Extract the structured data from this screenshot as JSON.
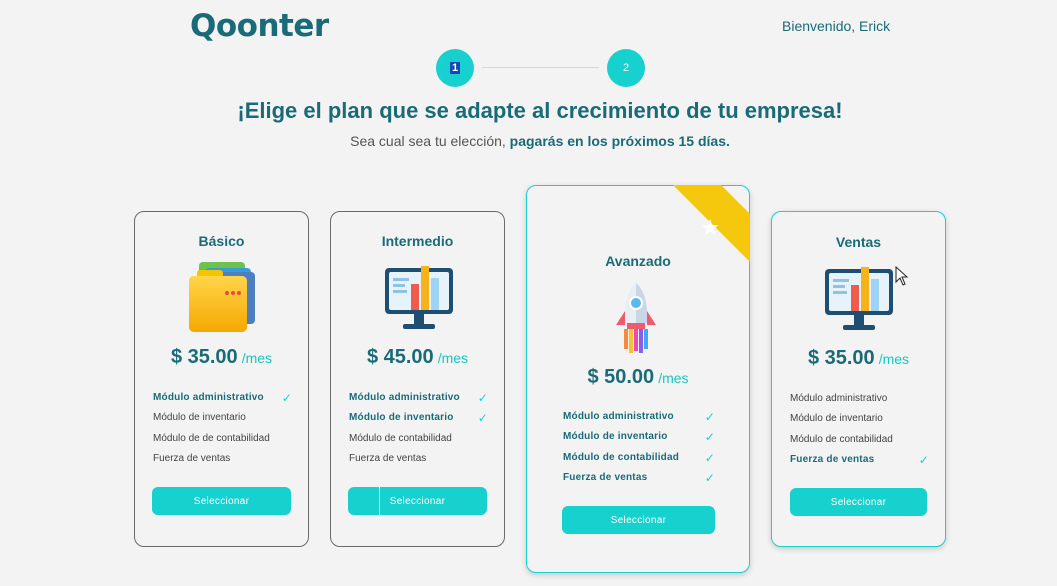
{
  "brand": {
    "logo": "Qoonter",
    "welcome": "Bienvenido, Erick"
  },
  "stepper": {
    "step1": "1",
    "step2": "2"
  },
  "headline": "¡Elige el plan que se adapte al crecimiento de tu empresa!",
  "subline": {
    "prefix": "Sea cual sea tu elección, ",
    "bold": "pagarás en los próximos 15 días."
  },
  "colors": {
    "accent": "#17d1cf",
    "brand": "#1a6b78",
    "ribbon": "#f5c80e"
  },
  "plans": [
    {
      "name": "Básico",
      "icon": "folders-icon",
      "price": "$ 35.00",
      "period": "/mes",
      "features": [
        "Módulo administrativo",
        "Módulo de inventario",
        "Módulo de de contabilidad",
        "Fuerza de ventas"
      ],
      "included": [
        true,
        false,
        false,
        false
      ],
      "button": "Seleccionar"
    },
    {
      "name": "Intermedio",
      "icon": "monitor-chart-icon",
      "price": "$ 45.00",
      "period": "/mes",
      "features": [
        "Módulo administrativo",
        "Módulo de inventario",
        "Módulo de contabilidad",
        "Fuerza de ventas"
      ],
      "included": [
        true,
        true,
        false,
        false
      ],
      "button": "Seleccionar"
    },
    {
      "name": "Avanzado",
      "icon": "rocket-icon",
      "price": "$ 50.00",
      "period": "/mes",
      "features": [
        "Módulo administrativo",
        "Módulo de inventario",
        "Módulo de contabilidad",
        "Fuerza de ventas"
      ],
      "included": [
        true,
        true,
        true,
        true
      ],
      "button": "Seleccionar",
      "featured": true
    },
    {
      "name": "Ventas",
      "icon": "monitor-chart-icon",
      "price": "$ 35.00",
      "period": "/mes",
      "features": [
        "Módulo administrativo",
        "Módulo de inventario",
        "Módulo de contabilidad",
        "Fuerza de ventas"
      ],
      "included": [
        false,
        false,
        false,
        true
      ],
      "button": "Seleccionar"
    }
  ]
}
